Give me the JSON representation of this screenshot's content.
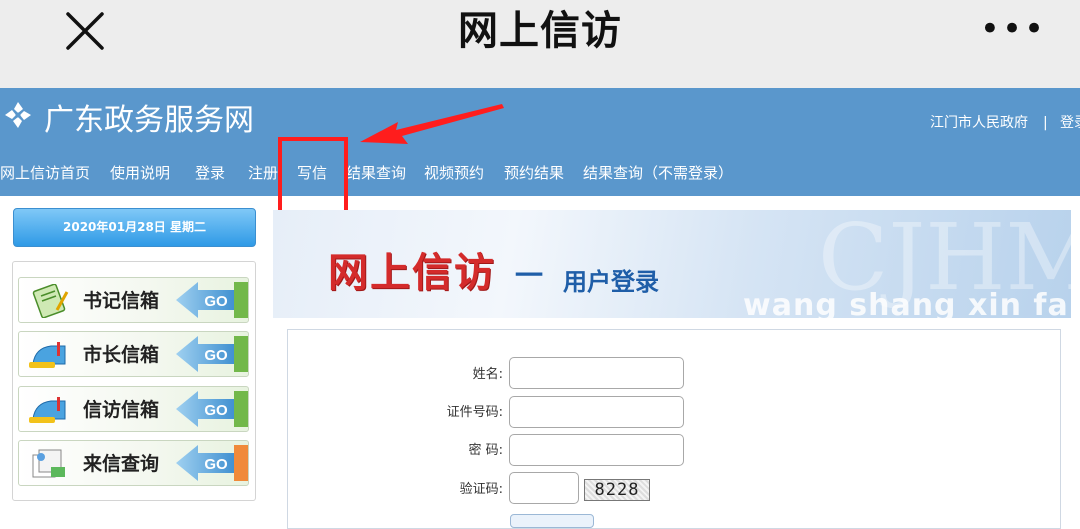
{
  "appbar": {
    "title": "网上信访",
    "close_icon": "close-icon",
    "more_icon": "more-icon",
    "more_text": "•••"
  },
  "header": {
    "site_name": "广东政务服务网",
    "city": "江门市人民政府",
    "separator": "|",
    "login": "登录"
  },
  "nav": [
    "网上信访首页",
    "使用说明",
    "登录",
    "注册",
    "写信",
    "结果查询",
    "视频预约",
    "预约结果",
    "结果查询（不需登录）"
  ],
  "sidebar": {
    "date": "2020年01月28日 星期二",
    "mailboxes": [
      {
        "label": "书记信箱",
        "go": "GO",
        "icon": "notebook-icon"
      },
      {
        "label": "市长信箱",
        "go": "GO",
        "icon": "mailbox-icon"
      },
      {
        "label": "信访信箱",
        "go": "GO",
        "icon": "mailbox-icon"
      },
      {
        "label": "来信查询",
        "go": "GO",
        "icon": "document-search-icon"
      }
    ]
  },
  "banner": {
    "title": "网上信访",
    "dash": "一",
    "subtitle": "用户登录",
    "pinyin": "wang shang xin fang",
    "watermark": "CJHM"
  },
  "form": {
    "name_label": "姓名:",
    "id_label": "证件号码:",
    "password_label": "密 码:",
    "captcha_label": "验证码:",
    "captcha_code": "8228"
  },
  "annotation": {
    "highlight_color": "#ff1d1d"
  },
  "colors": {
    "header_blue": "#5a97cc",
    "appbar_gray": "#ededed"
  }
}
